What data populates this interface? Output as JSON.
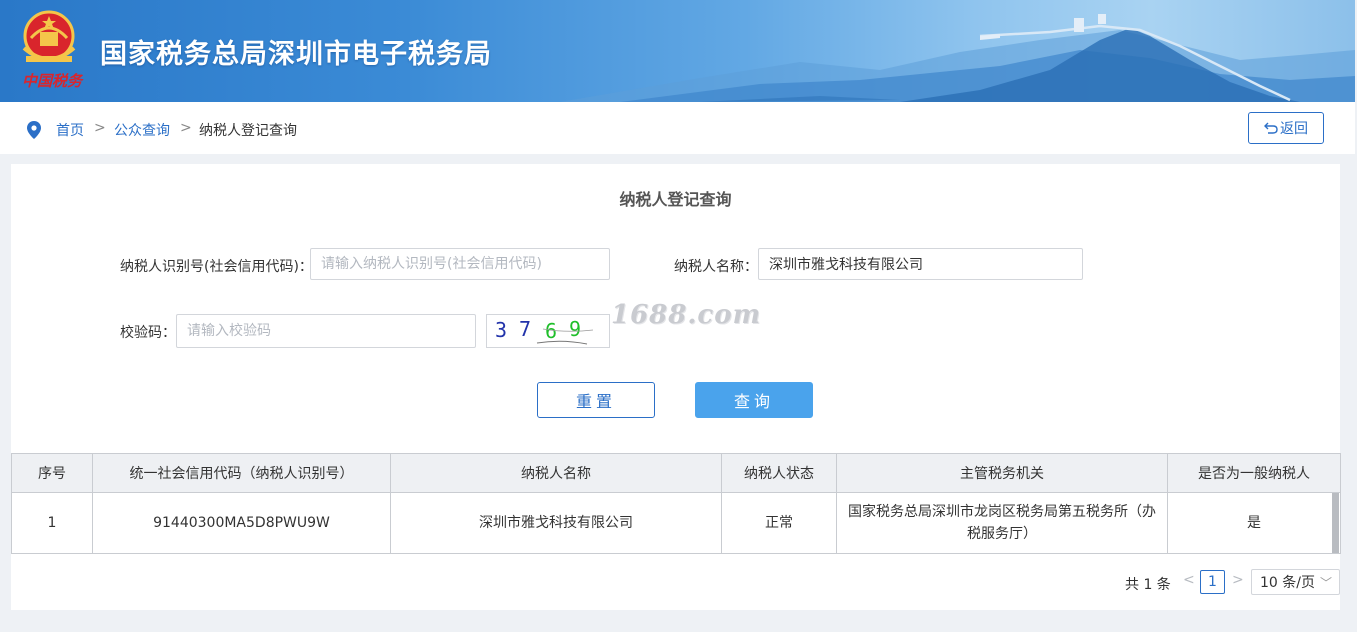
{
  "header": {
    "title": "国家税务总局深圳市电子税务局",
    "emblem_text": "中国税务",
    "colors": {
      "banner_start": "#2a78c8",
      "banner_end": "#a9d3f2"
    }
  },
  "breadcrumb": {
    "items": [
      "首页",
      "公众查询",
      "纳税人登记查询"
    ],
    "separator": ">",
    "back_label": "返回"
  },
  "form": {
    "title": "纳税人登记查询",
    "taxpayer_id": {
      "label": "纳税人识别号(社会信用代码)：",
      "value": "",
      "placeholder": "请输入纳税人识别号(社会信用代码)"
    },
    "taxpayer_name": {
      "label": "纳税人名称：",
      "value": "深圳市雅戈科技有限公司",
      "placeholder": ""
    },
    "captcha": {
      "label": "校验码：",
      "value": "",
      "placeholder": "请输入校验码",
      "image_digits": [
        "3",
        "7",
        "6",
        "9"
      ]
    },
    "reset_label": "重置",
    "query_label": "查询",
    "watermark": "1688.com"
  },
  "table": {
    "headers": [
      "序号",
      "统一社会信用代码（纳税人识别号）",
      "纳税人名称",
      "纳税人状态",
      "主管税务机关",
      "是否为一般纳税人"
    ],
    "rows": [
      [
        "1",
        "91440300MA5D8PWU9W",
        "深圳市雅戈科技有限公司",
        "正常",
        "国家税务总局深圳市龙岗区税务局第五税务所（办税服务厅）",
        "是"
      ]
    ]
  },
  "pagination": {
    "total": "共 1 条",
    "prev": "<",
    "next": ">",
    "current_page": "1",
    "page_size": "10 条/页"
  }
}
